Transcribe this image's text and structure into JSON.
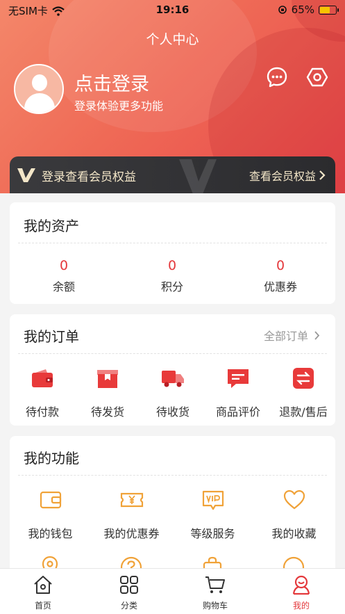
{
  "status_bar": {
    "carrier": "无SIM卡",
    "time": "19:16",
    "battery": "65%",
    "battery_level": 0.65
  },
  "header": {
    "title": "个人中心",
    "login_title": "点击登录",
    "login_subtitle": "登录体验更多功能",
    "message_icon": "chat-bubble-icon",
    "settings_icon": "hexagon-gear-icon"
  },
  "vip": {
    "text": "登录查看会员权益",
    "link": "查看会员权益"
  },
  "assets": {
    "title": "我的资产",
    "items": [
      {
        "value": "0",
        "label": "余额"
      },
      {
        "value": "0",
        "label": "积分"
      },
      {
        "value": "0",
        "label": "优惠券"
      }
    ]
  },
  "orders": {
    "title": "我的订单",
    "all_label": "全部订单",
    "items": [
      {
        "label": "待付款",
        "icon": "wallet-icon"
      },
      {
        "label": "待发货",
        "icon": "package-icon"
      },
      {
        "label": "待收货",
        "icon": "truck-icon"
      },
      {
        "label": "商品评价",
        "icon": "comment-icon"
      },
      {
        "label": "退款/售后",
        "icon": "refund-icon"
      }
    ]
  },
  "functions": {
    "title": "我的功能",
    "items": [
      {
        "label": "我的钱包",
        "icon": "wallet-outline-icon"
      },
      {
        "label": "我的优惠券",
        "icon": "coupon-icon"
      },
      {
        "label": "等级服务",
        "icon": "vip-badge-icon"
      },
      {
        "label": "我的收藏",
        "icon": "heart-icon"
      }
    ]
  },
  "tabbar": {
    "items": [
      {
        "label": "首页",
        "icon": "home-icon"
      },
      {
        "label": "分类",
        "icon": "grid-icon"
      },
      {
        "label": "购物车",
        "icon": "cart-icon"
      },
      {
        "label": "我的",
        "icon": "user-icon"
      }
    ],
    "active_index": 3
  },
  "colors": {
    "accent": "#e4393c",
    "vip_gold": "#f3e6c8",
    "function_icon": "#f0a238"
  }
}
